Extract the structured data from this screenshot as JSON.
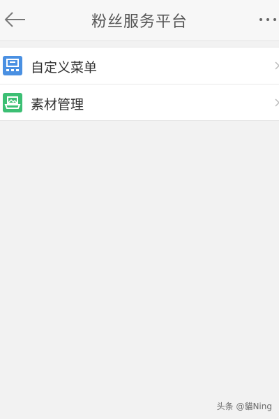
{
  "header": {
    "title": "粉丝服务平台",
    "back_icon": "arrow-left-icon",
    "more_icon": "more-horizontal-icon"
  },
  "menu": {
    "items": [
      {
        "label": "自定义菜单",
        "icon": "custom-menu-icon",
        "icon_color": "#4a90e2"
      },
      {
        "label": "素材管理",
        "icon": "material-library-icon",
        "icon_color": "#3cbf74"
      }
    ]
  },
  "watermark": "头条 @貓Ning",
  "colors": {
    "page_background": "#f2f2f2",
    "topbar_background": "#f7f7f7",
    "list_background": "#ffffff"
  }
}
